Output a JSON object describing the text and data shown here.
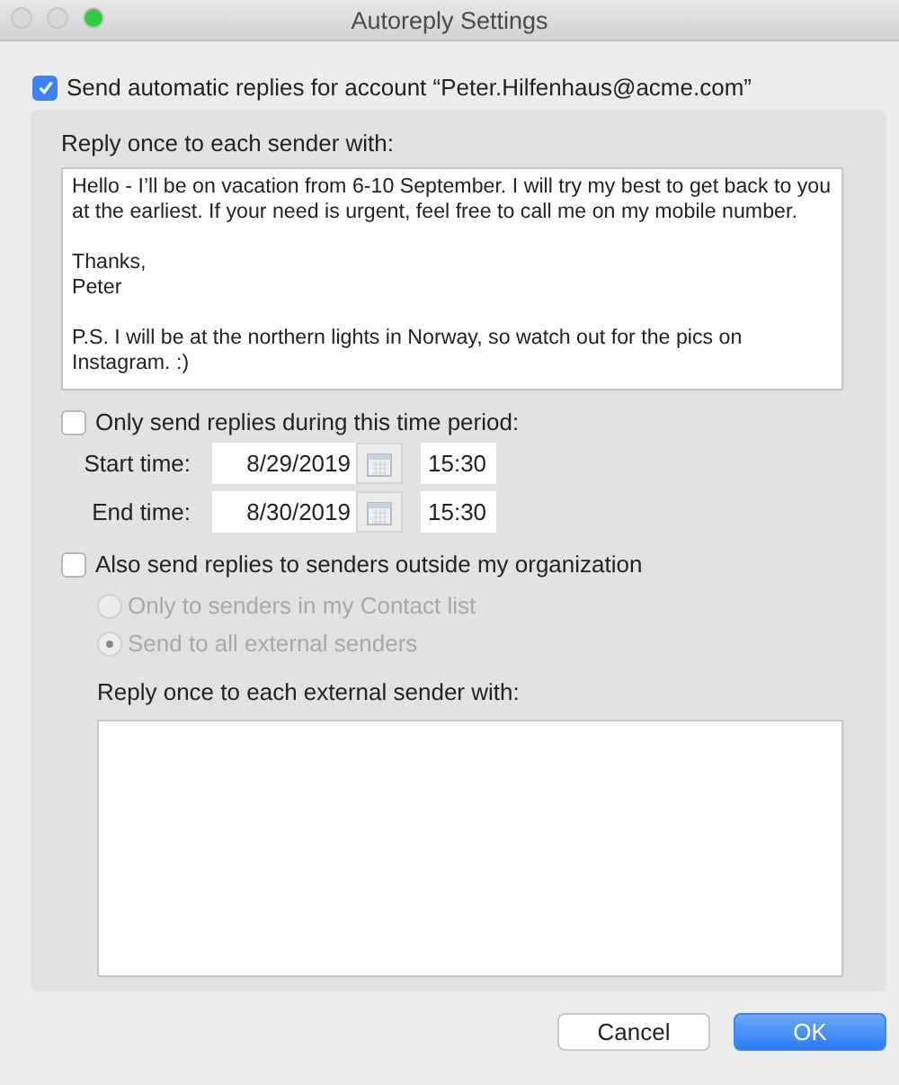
{
  "window": {
    "title": "Autoreply Settings",
    "buttons": [
      {
        "kind": "close"
      },
      {
        "kind": "minimize"
      },
      {
        "kind": "zoom"
      }
    ]
  },
  "enable": {
    "label": "Send automatic replies for account “Peter.Hilfenhaus@acme.com”",
    "checked": true
  },
  "reply": {
    "label": "Reply once to each sender with:",
    "paragraphs": [
      "Hello - I’ll be on vacation from 6-10 September. I will try my best to get back to you at the earliest. If your need is urgent, feel free to call me on my mobile number.",
      "Thanks,\nPeter",
      "P.S. I will be at the northern lights in Norway, so watch out for the pics on Instagram. :)"
    ]
  },
  "time_period": {
    "label": "Only send replies during this time period:",
    "checked": false,
    "rows": [
      {
        "label": "Start time:",
        "date": "8/29/2019",
        "time": "15:30"
      },
      {
        "label": "End time:",
        "date": "8/30/2019",
        "time": "15:30"
      }
    ]
  },
  "external": {
    "label": "Also send replies to senders outside my organization",
    "checked": false,
    "options": [
      {
        "label": "Only to senders in my Contact list",
        "selected": false,
        "disabled": true
      },
      {
        "label": "Send to all external senders",
        "selected": true,
        "disabled": true
      }
    ],
    "reply_label": "Reply once to each external sender with:"
  },
  "buttons": [
    {
      "label": "Cancel",
      "kind": "default"
    },
    {
      "label": "OK",
      "kind": "primary"
    }
  ]
}
